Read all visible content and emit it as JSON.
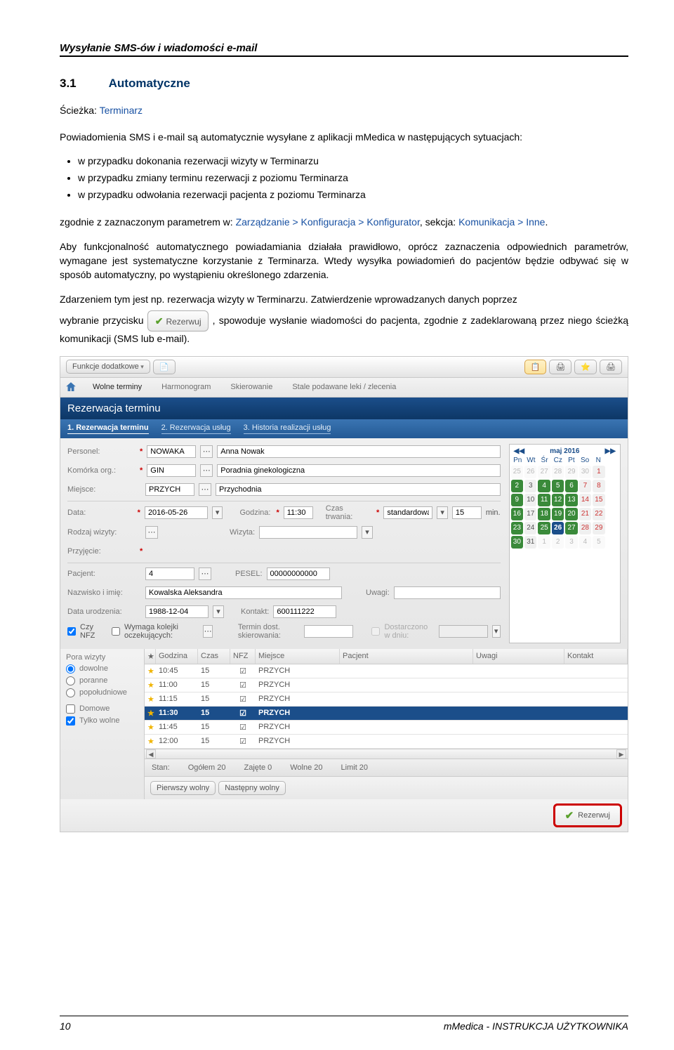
{
  "page": {
    "header_title": "Wysyłanie SMS-ów i wiadomości e-mail",
    "section_number": "3.1",
    "section_title": "Automatyczne",
    "sciezka_label": "Ścieżka:",
    "sciezka_value": "Terminarz",
    "para1": "Powiadomienia SMS i e-mail są automatycznie wysyłane z aplikacji mMedica w następujących sytuacjach:",
    "bullets": [
      "w przypadku dokonania rezerwacji wizyty w Terminarzu",
      "w przypadku zmiany terminu rezerwacji z poziomu Terminarza",
      "w przypadku odwołania rezerwacji pacjenta z poziomu Terminarza"
    ],
    "para2_a": "zgodnie z zaznaczonym parametrem w: ",
    "para2_link": "Zarządzanie > Konfiguracja > Konfigurator",
    "para2_b": ", sekcja: ",
    "para2_link2": "Komunikacja > Inne",
    "para2_c": ".",
    "para3": "Aby funkcjonalność automatycznego powiadamiania działała prawidłowo, oprócz zaznaczenia odpowiednich parametrów, wymagane jest systematyczne korzystanie z Terminarza. Wtedy wysyłka powiadomień do pacjentów będzie odbywać się w sposób automatyczny, po wystąpieniu określonego zdarzenia.",
    "para4": "Zdarzeniem tym jest np. rezerwacja wizyty w Terminarzu. Zatwierdzenie wprowadzanych danych poprzez",
    "para5_a": "wybranie przycisku ",
    "inline_btn": "Rezerwuj",
    "para5_b": ", spowoduje wysłanie wiadomości do pacjenta, zgodnie z zadeklarowaną przez niego ścieżką komunikacji (SMS lub e-mail).",
    "footer_page": "10",
    "footer_text": "mMedica - INSTRUKCJA UŻYTKOWNIKA"
  },
  "app": {
    "toolbar": {
      "func": "Funkcje dodatkowe"
    },
    "tabs": [
      "Wolne terminy",
      "Harmonogram",
      "Skierowanie",
      "Stale podawane leki / zlecenia"
    ],
    "banner": "Rezerwacja terminu",
    "subtabs": [
      "1. Rezerwacja terminu",
      "2. Rezerwacja usług",
      "3. Historia realizacji usług"
    ],
    "labels": {
      "personel": "Personel:",
      "komorka": "Komórka org.:",
      "miejsce": "Miejsce:",
      "data": "Data:",
      "godzina": "Godzina:",
      "czas": "Czas trwania:",
      "czas_unit": "min.",
      "rodzaj": "Rodzaj wizyty:",
      "wizyta": "Wizyta:",
      "przyjecie": "Przyjęcie:",
      "pacjent": "Pacjent:",
      "pesel": "PESEL:",
      "nazwisko": "Nazwisko i imię:",
      "data_ur": "Data urodzenia:",
      "kontakt": "Kontakt:",
      "uwagi": "Uwagi:",
      "czy_nfz": "Czy NFZ",
      "wymaga": "Wymaga kolejki oczekujących:",
      "termin_dost": "Termin dost. skierowania:",
      "dostarczono": "Dostarczono w dniu:"
    },
    "values": {
      "personel_code": "NOWAKA",
      "personel_name": "Anna Nowak",
      "komorka_code": "GIN",
      "komorka_name": "Poradnia ginekologiczna",
      "miejsce_code": "PRZYCH",
      "miejsce_name": "Przychodnia",
      "data": "2016-05-26",
      "godzina": "11:30",
      "czas_type": "standardowa",
      "czas_val": "15",
      "pacjent": "4",
      "pesel": "00000000000",
      "nazwisko": "Kowalska Aleksandra",
      "data_ur": "1988-12-04",
      "kontakt": "600111222"
    },
    "calendar": {
      "title": "maj 2016",
      "dow": [
        "Pn",
        "Wt",
        "Śr",
        "Cz",
        "Pt",
        "So",
        "N"
      ]
    },
    "schedule": {
      "side": {
        "title": "Pora wizyty",
        "opts": [
          "dowolne",
          "poranne",
          "popołudniowe"
        ],
        "domowe": "Domowe",
        "tylko": "Tylko wolne"
      },
      "head": [
        "",
        "Godzina",
        "Czas",
        "NFZ",
        "Miejsce",
        "Pacjent",
        "Uwagi",
        "Kontakt"
      ],
      "rows": [
        {
          "time": "10:45",
          "dur": "15",
          "place": "PRZYCH"
        },
        {
          "time": "11:00",
          "dur": "15",
          "place": "PRZYCH"
        },
        {
          "time": "11:15",
          "dur": "15",
          "place": "PRZYCH"
        },
        {
          "time": "11:30",
          "dur": "15",
          "place": "PRZYCH"
        },
        {
          "time": "11:45",
          "dur": "15",
          "place": "PRZYCH"
        },
        {
          "time": "12:00",
          "dur": "15",
          "place": "PRZYCH"
        }
      ],
      "footer": {
        "stan": "Stan:",
        "ogolem": "Ogółem 20",
        "zajete": "Zajęte 0",
        "wolne": "Wolne 20",
        "limit": "Limit 20"
      },
      "btns": {
        "pierwszy": "Pierwszy wolny",
        "nastepny": "Następny wolny"
      }
    },
    "reserve_btn": "Rezerwuj"
  }
}
